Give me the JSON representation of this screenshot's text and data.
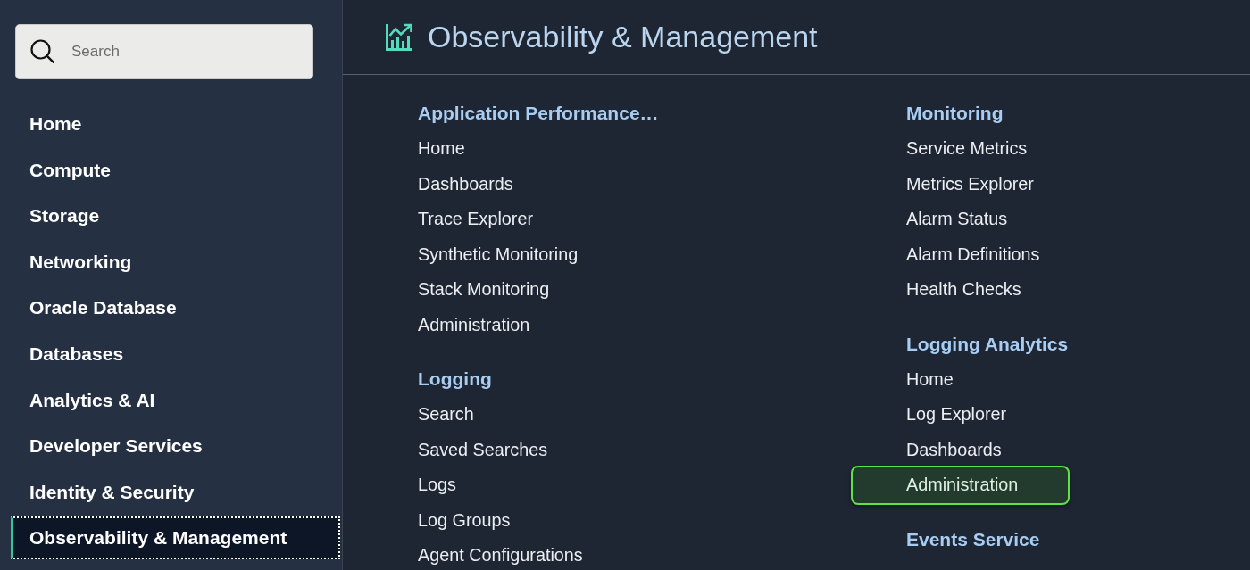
{
  "search": {
    "placeholder": "Search"
  },
  "sidebar": {
    "items": [
      {
        "label": "Home",
        "selected": false
      },
      {
        "label": "Compute",
        "selected": false
      },
      {
        "label": "Storage",
        "selected": false
      },
      {
        "label": "Networking",
        "selected": false
      },
      {
        "label": "Oracle Database",
        "selected": false
      },
      {
        "label": "Databases",
        "selected": false
      },
      {
        "label": "Analytics & AI",
        "selected": false
      },
      {
        "label": "Developer Services",
        "selected": false
      },
      {
        "label": "Identity & Security",
        "selected": false
      },
      {
        "label": "Observability & Management",
        "selected": true
      }
    ]
  },
  "header": {
    "title": "Observability & Management"
  },
  "columns": [
    {
      "sections": [
        {
          "heading": "Application Performance…",
          "items": [
            {
              "label": "Home",
              "selected": false
            },
            {
              "label": "Dashboards",
              "selected": false
            },
            {
              "label": "Trace Explorer",
              "selected": false
            },
            {
              "label": "Synthetic Monitoring",
              "selected": false
            },
            {
              "label": "Stack Monitoring",
              "selected": false
            },
            {
              "label": "Administration",
              "selected": false
            }
          ]
        },
        {
          "heading": "Logging",
          "items": [
            {
              "label": "Search",
              "selected": false
            },
            {
              "label": "Saved Searches",
              "selected": false
            },
            {
              "label": "Logs",
              "selected": false
            },
            {
              "label": "Log Groups",
              "selected": false
            },
            {
              "label": "Agent Configurations",
              "selected": false
            }
          ]
        }
      ]
    },
    {
      "sections": [
        {
          "heading": "Monitoring",
          "items": [
            {
              "label": "Service Metrics",
              "selected": false
            },
            {
              "label": "Metrics Explorer",
              "selected": false
            },
            {
              "label": "Alarm Status",
              "selected": false
            },
            {
              "label": "Alarm Definitions",
              "selected": false
            },
            {
              "label": "Health Checks",
              "selected": false
            }
          ]
        },
        {
          "heading": "Logging Analytics",
          "items": [
            {
              "label": "Home",
              "selected": false
            },
            {
              "label": "Log Explorer",
              "selected": false
            },
            {
              "label": "Dashboards",
              "selected": false
            },
            {
              "label": "Administration",
              "selected": true
            }
          ]
        },
        {
          "heading": "Events Service"
        }
      ]
    }
  ]
}
